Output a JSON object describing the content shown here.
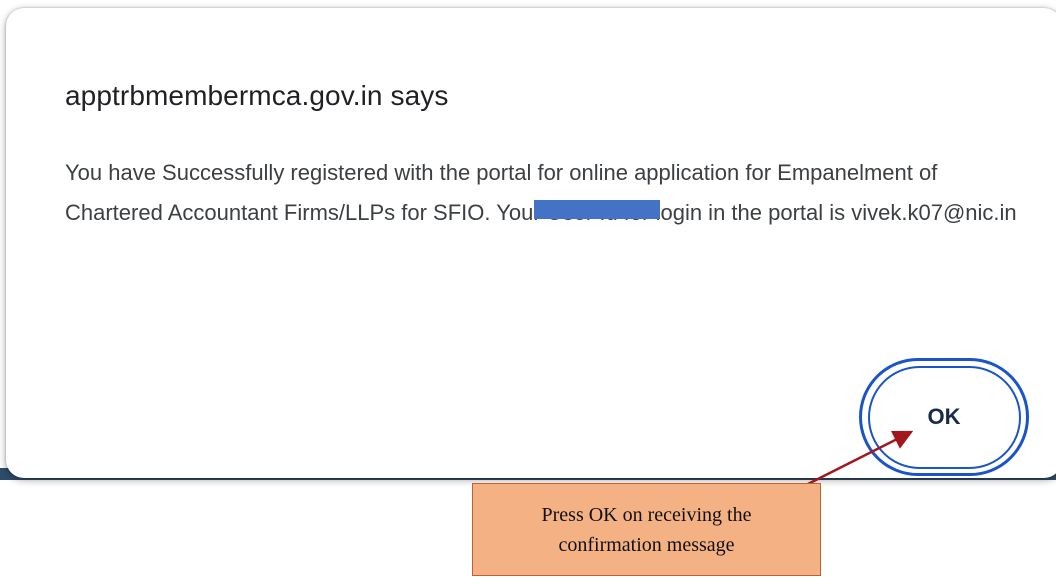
{
  "dialog": {
    "title": "apptrbmembermca.gov.in says",
    "message": "You have Successfully registered with the portal for online application for Empanelment of Chartered Accountant Firms/LLPs for SFIO. Your User Id for login in the portal is vivek.k07@nic.in",
    "ok_label": "OK"
  },
  "annotation": {
    "callout_text": "Press OK on receiving the confirmation message"
  },
  "colors": {
    "button_border": "#1a54c7",
    "callout_fill": "#f4b183",
    "arrow": "#a3161b",
    "redaction": "#4472c4",
    "backdrop_strip": "#2e4d6a"
  }
}
